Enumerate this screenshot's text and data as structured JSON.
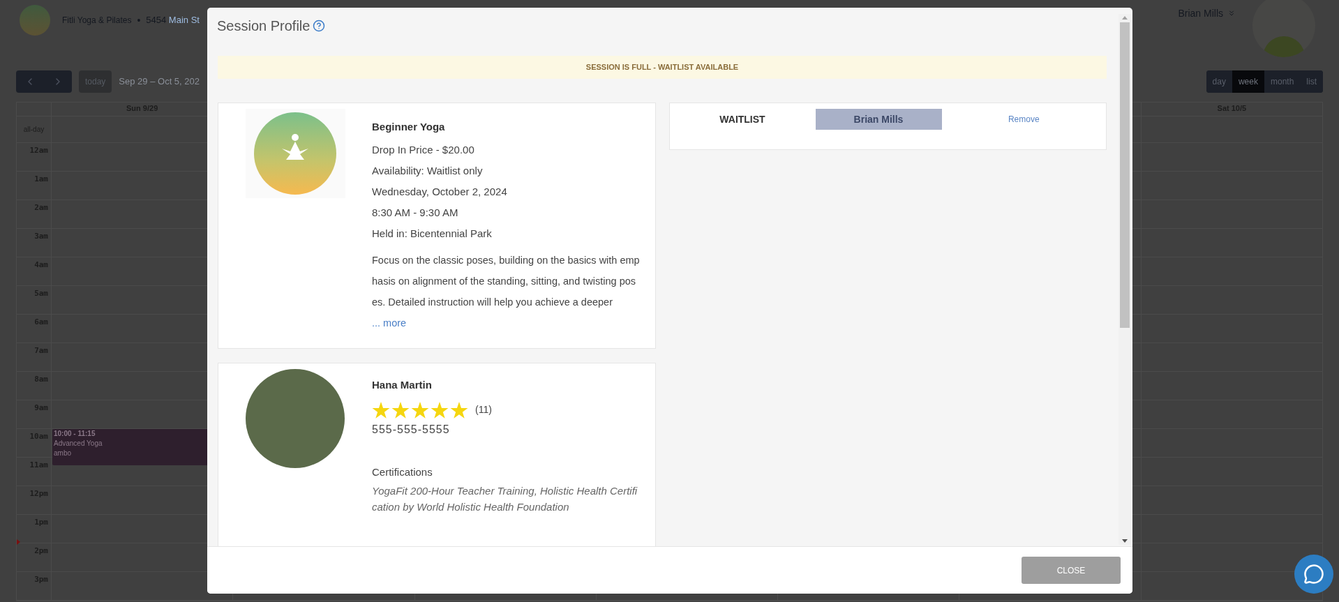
{
  "header": {
    "business": "Fitli Yoga & Pilates",
    "separator": "•",
    "address_number": "5454",
    "address_street": "Main St",
    "user": "Brian Mills"
  },
  "toolbar": {
    "today": "today",
    "range": "Sep 29 – Oct 5, 202",
    "views": [
      {
        "label": "day",
        "selected": false
      },
      {
        "label": "week",
        "selected": true
      },
      {
        "label": "month",
        "selected": false
      },
      {
        "label": "list",
        "selected": false
      }
    ]
  },
  "calendar": {
    "first_day": "Sun 9/29",
    "last_day": "Sat 10/5",
    "all_day": "all-day",
    "hours": [
      {
        "label": "12am"
      },
      {
        "label": "1am"
      },
      {
        "label": "2am"
      },
      {
        "label": "3am"
      },
      {
        "label": "4am"
      },
      {
        "label": "5am"
      },
      {
        "label": "6am"
      },
      {
        "label": "7am"
      },
      {
        "label": "8am"
      },
      {
        "label": "9am"
      },
      {
        "label": "10am",
        "events": [
          {
            "time": "10:00 - 11:15",
            "title": "Advanced Yoga",
            "location": "ambo"
          }
        ]
      },
      {
        "label": "11am"
      },
      {
        "label": "12pm"
      },
      {
        "label": "1pm"
      },
      {
        "label": "2pm",
        "now": true
      },
      {
        "label": "3pm"
      }
    ]
  },
  "modal": {
    "title": "Session Profile",
    "banner": "SESSION IS FULL - WAITLIST AVAILABLE",
    "session": {
      "name": "Beginner Yoga",
      "details": [
        "Drop In Price - $20.00",
        "Availability: Waitlist only",
        "Wednesday, October 2, 2024",
        "8:30 AM - 9:30 AM",
        "Held in: Bicentennial Park"
      ],
      "description": "Focus on the classic poses, building on the basics with emphasis on alignment of the standing, sitting, and twisting poses. Detailed instruction will help you achieve a deeper",
      "more_link": "... more"
    },
    "instructor": {
      "name": "Hana Martin",
      "stars": 5,
      "rating_count": "(11)",
      "phone": "555-555-5555",
      "certifications_label": "Certifications",
      "certifications": "YogaFit 200-Hour Teacher Training, Holistic Health Certification by World Holistic Health Foundation"
    },
    "waitlist": {
      "label": "WAITLIST",
      "name": "Brian Mills",
      "action": "Remove"
    },
    "close": "CLOSE"
  }
}
